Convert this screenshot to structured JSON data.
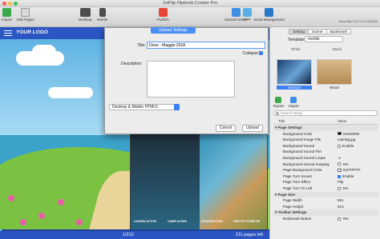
{
  "window": {
    "title": "1stFlip Flipbook Creator Pro"
  },
  "toolbar": {
    "buttons": [
      {
        "label": "Import"
      },
      {
        "label": "Edit Pages"
      },
      {
        "label": "Desktop"
      },
      {
        "label": "Mobile"
      },
      {
        "label": "Publish"
      },
      {
        "label": "Upload Online"
      },
      {
        "label": "FTP"
      },
      {
        "label": "Book Management"
      }
    ],
    "url": "View http://127.0.0.1:53332"
  },
  "preview": {
    "logo": "YOUR LOGO",
    "page_number": "1/212",
    "pages_left": "211 pages left",
    "progress": 0.005,
    "book_captions": [
      "LIGURIA ACTIVE",
      "CAMPI ALPINI",
      "SPIAGGE FOOD",
      "GROTTE STORICHE"
    ]
  },
  "dialog": {
    "title": "Upload Settings",
    "title_label": "Title:",
    "title_value": "Dove - Maggio 2018",
    "collapse": "Collapse",
    "description_label": "Description:",
    "platform": "Desktop & Mobile HTML5",
    "cancel": "Cancel",
    "upload": "Upload"
  },
  "panel": {
    "tabs": [
      "Setting",
      "Scene",
      "Bookmark"
    ],
    "template_label": "Template:",
    "template_value": "mobile",
    "templates": [
      {
        "top": "White",
        "caption": "Abstract",
        "selected": true
      },
      {
        "top": "Black",
        "caption": "Wood",
        "selected": false
      }
    ],
    "actions": [
      "Export",
      "Import"
    ],
    "search_placeholder": "Search string",
    "prop_headers": {
      "name": "Title",
      "value": "Value"
    },
    "properties": [
      {
        "group": true,
        "name": "Page Settings"
      },
      {
        "name": "Background Color",
        "value": "0x000000",
        "swatch": "#000000"
      },
      {
        "name": "Background Image File",
        "value": "mainbg.jpg"
      },
      {
        "name": "Background Sound",
        "value": "Enable",
        "check": false
      },
      {
        "name": "Background Sound File",
        "value": ""
      },
      {
        "name": "Background Sound Loops",
        "value": "-1"
      },
      {
        "name": "Background Sound Autoplay",
        "value": "Yes",
        "check": false
      },
      {
        "name": "Page Background Color",
        "value": "0xFFFFFF",
        "swatch": "#ffffff"
      },
      {
        "name": "Page Turn Sound",
        "value": "Enable",
        "check": true
      },
      {
        "name": "Page Turn Effect",
        "value": "Flip"
      },
      {
        "name": "Page Turn To Left",
        "value": "Yes",
        "check": false
      },
      {
        "group": true,
        "name": "Page Size"
      },
      {
        "name": "Page Width",
        "value": "651"
      },
      {
        "name": "Page Height",
        "value": "913"
      },
      {
        "group": true,
        "name": "Toolbar Settings"
      },
      {
        "name": "Bookmark Button",
        "value": "Yes",
        "check": false
      }
    ]
  }
}
